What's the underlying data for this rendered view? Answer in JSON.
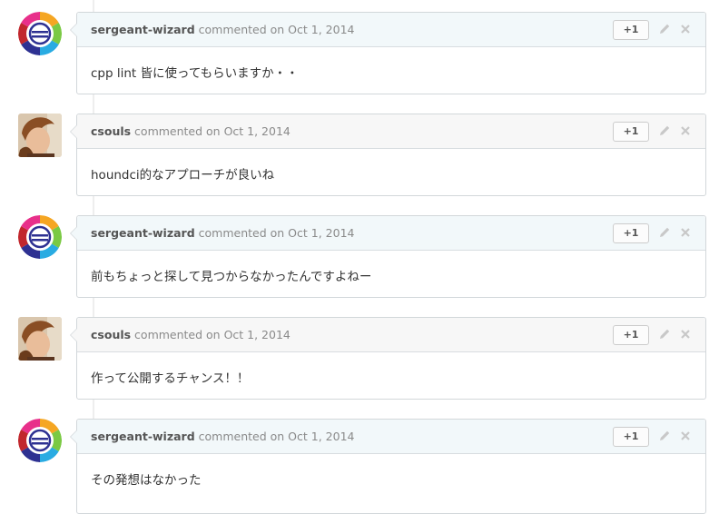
{
  "comments": [
    {
      "author": "sergeant-wizard",
      "meta": "commented on Oct 1, 2014",
      "body": "cpp lint 皆に使ってもらいますか・・",
      "plus_one": "+1",
      "avatar_icon": "wizard-logo-icon"
    },
    {
      "author": "csouls",
      "meta": "commented on Oct 1, 2014",
      "body": "houndci的なアプローチが良いね",
      "plus_one": "+1",
      "avatar_icon": "person-photo"
    },
    {
      "author": "sergeant-wizard",
      "meta": "commented on Oct 1, 2014",
      "body": "前もちょっと探して見つからなかったんですよねー",
      "plus_one": "+1",
      "avatar_icon": "wizard-logo-icon"
    },
    {
      "author": "csouls",
      "meta": "commented on Oct 1, 2014",
      "body": "作って公開するチャンス！！",
      "plus_one": "+1",
      "avatar_icon": "person-photo"
    },
    {
      "author": "sergeant-wizard",
      "meta": "commented on Oct 1, 2014",
      "body": "その発想はなかった",
      "plus_one": "+1",
      "avatar_icon": "wizard-logo-icon"
    }
  ],
  "colors": {
    "own_header_bg": "#f2f8fa",
    "other_header_bg": "#f7f7f7",
    "border": "#d2d7da"
  }
}
